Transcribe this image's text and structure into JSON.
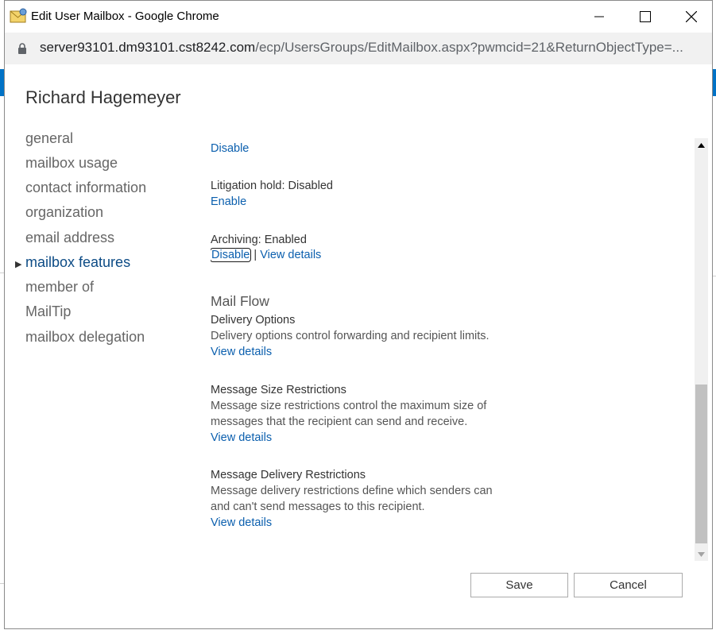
{
  "window": {
    "title": "Edit User Mailbox - Google Chrome",
    "url_host": "server93101.dm93101.cst8242.com",
    "url_path": "/ecp/UsersGroups/EditMailbox.aspx?pwmcid=21&ReturnObjectType=..."
  },
  "dialog": {
    "title": "Richard Hagemeyer"
  },
  "nav": {
    "items": [
      {
        "label": "general"
      },
      {
        "label": "mailbox usage"
      },
      {
        "label": "contact information"
      },
      {
        "label": "organization"
      },
      {
        "label": "email address"
      },
      {
        "label": "mailbox features"
      },
      {
        "label": "member of"
      },
      {
        "label": "MailTip"
      },
      {
        "label": "mailbox delegation"
      }
    ],
    "active_index": 5
  },
  "content": {
    "top_link": "Disable",
    "litigation_status": "Litigation hold: Disabled",
    "litigation_link": "Enable",
    "archiving_status": "Archiving: Enabled",
    "archiving_disable": "Disable",
    "archiving_sep": "|",
    "archiving_view": "View details",
    "mail_flow_title": "Mail Flow",
    "delivery_title": "Delivery Options",
    "delivery_desc": "Delivery options control forwarding and recipient limits.",
    "delivery_link": "View details",
    "size_title": "Message Size Restrictions",
    "size_desc1": "Message size restrictions control the maximum size of",
    "size_desc2": "messages that the recipient can send and receive.",
    "size_link": "View details",
    "deliv_restr_title": "Message Delivery Restrictions",
    "deliv_restr_desc1": "Message delivery restrictions define which senders can",
    "deliv_restr_desc2": "and can't send messages to this recipient.",
    "deliv_restr_link": "View details"
  },
  "buttons": {
    "save": "Save",
    "cancel": "Cancel"
  },
  "colors": {
    "link": "#0b5fae",
    "active_nav": "#0c4b85",
    "header_blue": "#0072c6"
  }
}
